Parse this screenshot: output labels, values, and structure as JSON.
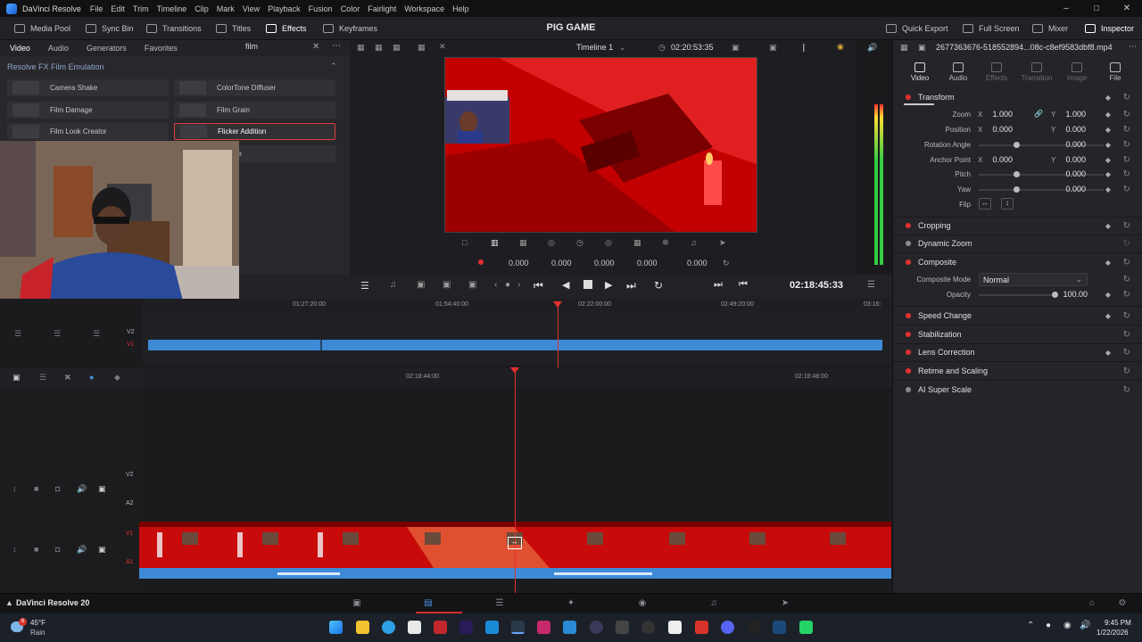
{
  "app": {
    "name": "DaVinci Resolve",
    "menus": [
      "File",
      "Edit",
      "Trim",
      "Timeline",
      "Clip",
      "Mark",
      "View",
      "Playback",
      "Fusion",
      "Color",
      "Fairlight",
      "Workspace",
      "Help"
    ],
    "window_controls": [
      "minimize-icon",
      "maximize-icon",
      "close-icon"
    ]
  },
  "toolbar": {
    "media_pool": "Media Pool",
    "sync_bin": "Sync Bin",
    "transitions": "Transitions",
    "titles": "Titles",
    "effects": "Effects",
    "keyframes": "Keyframes",
    "project_title": "PIG GAME",
    "quick_export": "Quick Export",
    "full_screen": "Full Screen",
    "mixer": "Mixer",
    "inspector": "Inspector"
  },
  "effects_panel": {
    "tabs": [
      "Video",
      "Audio",
      "Generators",
      "Favorites"
    ],
    "selected_tab": "Video",
    "search_value": "film",
    "category": "Resolve FX Film Emulation",
    "items": [
      {
        "label": "Camera Shake",
        "selected": false
      },
      {
        "label": "ColorTone Diffuser",
        "selected": false
      },
      {
        "label": "Film Damage",
        "selected": false
      },
      {
        "label": "Film Grain",
        "selected": false
      },
      {
        "label": "Film Look Creator",
        "selected": false
      },
      {
        "label": "Flicker Addition",
        "selected": true
      },
      {
        "label": "ne",
        "selected": false
      }
    ]
  },
  "viewer": {
    "timeline_name": "Timeline 1",
    "source_timecode": "02:20:53:35",
    "transform_values": [
      "0.000",
      "0.000",
      "0.000",
      "0.000",
      "0.000"
    ]
  },
  "transport": {
    "timecode": "02:18:45:33"
  },
  "upper_timeline": {
    "ruler": [
      "01:27:20:00",
      "01:54:40:00",
      "02:22:00:00",
      "02:49:20:00",
      "03:16:"
    ],
    "tracks": [
      "V2",
      "V1"
    ]
  },
  "lower_timeline": {
    "ruler": [
      "02:18:44:00",
      "02:18:48:00"
    ],
    "tracks": [
      "V2",
      "A2",
      "V1",
      "A1"
    ]
  },
  "inspector": {
    "file_name": "2677363676-518552894...08c-c8ef9583dbf8.mp4",
    "tabs": [
      "Video",
      "Audio",
      "Effects",
      "Transition",
      "Image",
      "File"
    ],
    "selected_tab": "Video",
    "transform": {
      "title": "Transform",
      "zoom_label": "Zoom",
      "zoom_x": "1.000",
      "zoom_y": "1.000",
      "position_label": "Position",
      "position_x": "0.000",
      "position_y": "0.000",
      "rotation_label": "Rotation Angle",
      "rotation": "0.000",
      "anchor_label": "Anchor Point",
      "anchor_x": "0.000",
      "anchor_y": "0.000",
      "pitch_label": "Pitch",
      "pitch": "0.000",
      "yaw_label": "Yaw",
      "yaw": "0.000",
      "flip_label": "Flip",
      "axis_x": "X",
      "axis_y": "Y"
    },
    "sections": {
      "cropping": "Cropping",
      "dynamic_zoom": "Dynamic Zoom",
      "composite": "Composite",
      "speed_change": "Speed Change",
      "stabilization": "Stabilization",
      "lens_correction": "Lens Correction",
      "retime_scaling": "Retime and Scaling",
      "ai_super_scale": "AI Super Scale"
    },
    "composite": {
      "mode_label": "Composite Mode",
      "mode_value": "Normal",
      "opacity_label": "Opacity",
      "opacity_value": "100.00"
    }
  },
  "pagebar": {
    "brand": "DaVinci Resolve 20",
    "pages": [
      "media-page-icon",
      "cut-page-icon",
      "edit-page-icon",
      "fusion-page-icon",
      "color-page-icon",
      "fairlight-page-icon",
      "deliver-page-icon"
    ],
    "selected_page": "cut-page-icon"
  },
  "taskbar": {
    "weather_temp": "45°F",
    "weather_condition": "Rain",
    "weather_badge": "6",
    "time": "9:45 PM",
    "date": "1/22/2026"
  },
  "colors": {
    "accent_red": "#e23030",
    "clip_blue": "#3e8ad6",
    "clip_red": "#c30606"
  }
}
